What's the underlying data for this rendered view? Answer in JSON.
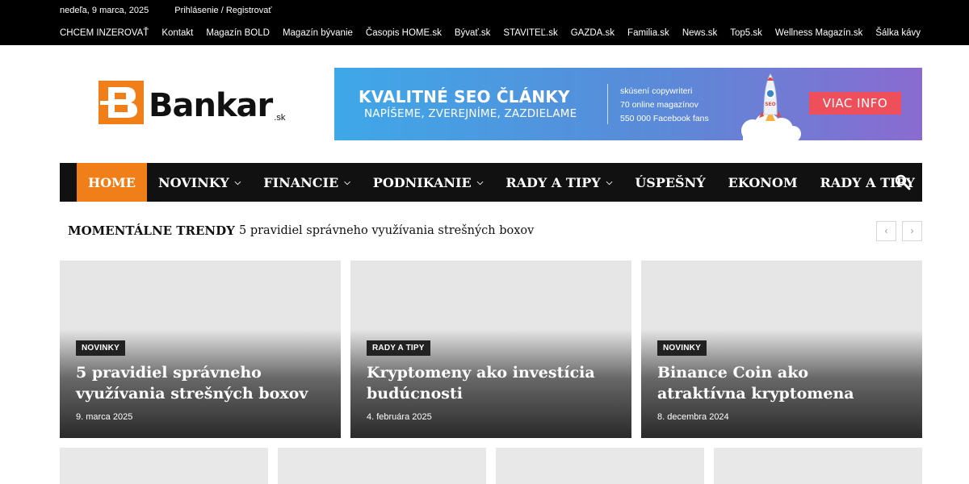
{
  "topbar": {
    "date": "nedeľa, 9 marca, 2025",
    "login": "Prihlásenie / Registrovať",
    "links": [
      "CHCEM INZEROVAŤ",
      "Kontakt",
      "Magazín BOLD",
      "Magazín bývanie",
      "Časopis HOME.sk",
      "Bývať.sk",
      "STAVITEĽ.sk",
      "GAZDA.sk",
      "Familia.sk",
      "News.sk",
      "Top5.sk",
      "Wellness Magazín.sk",
      "Šálka kávy"
    ]
  },
  "logo": {
    "letter": "B",
    "word": "Bankar",
    "tld": ".sk",
    "color": "#f07f1a"
  },
  "banner": {
    "headline": "KVALITNÉ SEO ČLÁNKY",
    "subline": "NAPÍŠEME, ZVEREJNÍME, ZAZDIELAME",
    "info": [
      "skúsení copywriteri",
      "70 online magazínov",
      "550 000 Facebook fans"
    ],
    "rocket_label": "SEO",
    "button": "VIAC INFO"
  },
  "nav": {
    "items": [
      {
        "label": "HOME",
        "dropdown": false,
        "active": true
      },
      {
        "label": "NOVINKY",
        "dropdown": true,
        "active": false
      },
      {
        "label": "FINANCIE",
        "dropdown": true,
        "active": false
      },
      {
        "label": "PODNIKANIE",
        "dropdown": true,
        "active": false
      },
      {
        "label": "RADY A TIPY",
        "dropdown": true,
        "active": false
      },
      {
        "label": "ÚSPEŠNÝ",
        "dropdown": false,
        "active": false
      },
      {
        "label": "EKONOM",
        "dropdown": false,
        "active": false
      },
      {
        "label": "RADY A TIPY",
        "dropdown": false,
        "active": false
      }
    ],
    "search_icon": "search-icon"
  },
  "trending": {
    "label": "MOMENTÁLNE TRENDY",
    "text": "5 pravidiel správneho využívania strešných boxov",
    "prev": "‹",
    "next": "›"
  },
  "cards": [
    {
      "category": "NOVINKY",
      "title": "5 pravidiel správneho využívania strešných boxov",
      "date": "9. marca 2025"
    },
    {
      "category": "RADY A TIPY",
      "title": "Kryptomeny ako investícia budúcnosti",
      "date": "4. februára 2025"
    },
    {
      "category": "NOVINKY",
      "title": "Binance Coin ako atraktívna kryptomena",
      "date": "8. decembra 2024"
    }
  ]
}
